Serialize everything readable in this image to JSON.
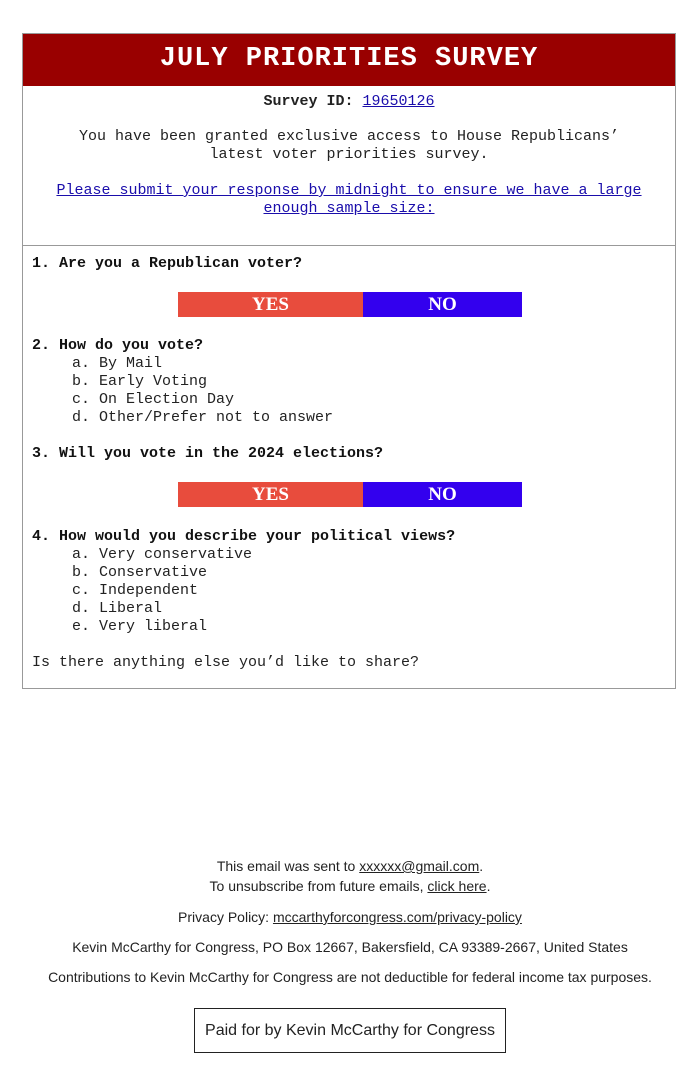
{
  "banner": {
    "title": "JULY PRIORITIES SURVEY",
    "bg_color": "#990000"
  },
  "intro": {
    "survey_id_label": "Survey ID:",
    "survey_id": "19650126",
    "description": "You have been granted exclusive access to House Republicans’ latest voter priorities survey.",
    "cta_link": "Please submit your response by midnight to ensure we have a large enough sample size:"
  },
  "questions": [
    {
      "text": "1. Are you a Republican voter?",
      "yes": "YES",
      "no": "NO"
    },
    {
      "text": "2. How do you vote?",
      "options": [
        "a. By Mail",
        "b. Early Voting",
        "c. On Election Day",
        "d. Other/Prefer not to answer"
      ]
    },
    {
      "text": "3. Will you vote in the 2024 elections?",
      "yes": "YES",
      "no": "NO"
    },
    {
      "text": "4. How would you describe your political views?",
      "options": [
        "a. Very conservative",
        "b. Conservative",
        "c. Independent",
        "d. Liberal",
        "e. Very liberal"
      ]
    }
  ],
  "closing_question": "Is there anything else you’d like to share?",
  "colors": {
    "yes": "#e84c3d",
    "no": "#3300ee"
  },
  "footer": {
    "sent_to_prefix": "This email was sent to ",
    "email": "xxxxxx@gmail.com",
    "sent_to_suffix": ".",
    "unsubscribe_prefix": "To unsubscribe from future emails, ",
    "unsubscribe_link": "click here",
    "unsubscribe_suffix": ".",
    "privacy_label": "Privacy Policy: ",
    "privacy_link": "mccarthyforcongress.com/privacy-policy",
    "address": "Kevin McCarthy for Congress, PO Box 12667, Bakersfield, CA 93389-2667, United States",
    "disclaimer": "Contributions to Kevin McCarthy for Congress are not deductible for federal income tax purposes.",
    "paid_for": "Paid for by Kevin McCarthy for Congress"
  }
}
